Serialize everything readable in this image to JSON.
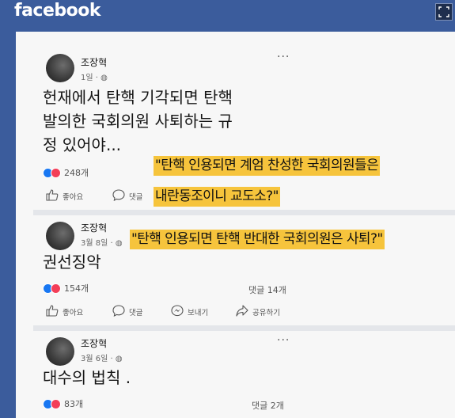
{
  "app": {
    "logo": "facebook"
  },
  "toolbar": {
    "expand_icon": "expand-icon"
  },
  "posts": [
    {
      "author": "조장혁",
      "time": "1일 · ",
      "text": "헌재에서 탄핵 기각되면 탄핵\n발의한 국회의원 사퇴하는 규\n정 있어야...",
      "reaction_count": "248개",
      "comment_count": "",
      "actions": [
        {
          "label": "좋아요"
        },
        {
          "label": "댓글"
        }
      ]
    },
    {
      "author": "조장혁",
      "time": "3월 8일 · ",
      "text": "권선징악",
      "reaction_count": "154개",
      "comment_count": "댓글 14개",
      "actions": [
        {
          "label": "좋아요"
        },
        {
          "label": "댓글"
        },
        {
          "label": "보내기"
        },
        {
          "label": "공유하기"
        }
      ]
    },
    {
      "author": "조장혁",
      "time": "3월 6일 · ",
      "text": "대수의 법칙 .",
      "reaction_count": "83개",
      "comment_count": "댓글 2개"
    }
  ],
  "captions": [
    {
      "text": "\"탄핵 인용되면 계엄 찬성한 국회의원들은"
    },
    {
      "text": "내란동조이니 교도소?\""
    },
    {
      "text": "\"탄핵 인용되면 탄핵 반대한 국회의원은 사퇴?\""
    }
  ],
  "colors": {
    "header": "#3b5c9c",
    "highlight": "#f6c43c",
    "card": "#f7f7f7"
  }
}
